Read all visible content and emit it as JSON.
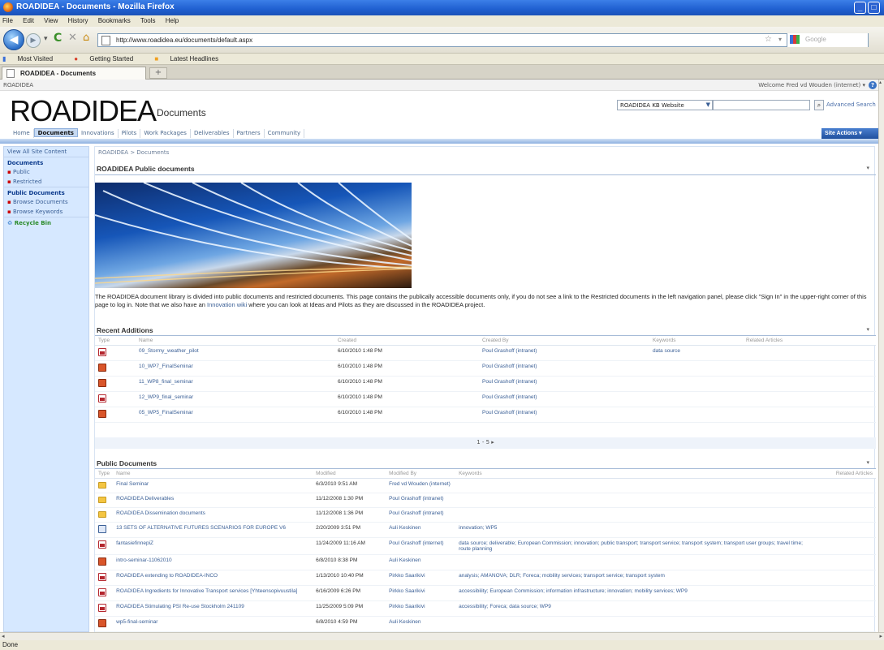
{
  "browser": {
    "window_title": "ROADIDEA - Documents - Mozilla Firefox",
    "menu": [
      "File",
      "Edit",
      "View",
      "History",
      "Bookmarks",
      "Tools",
      "Help"
    ],
    "url": "http://www.roadidea.eu/documents/default.aspx",
    "search_engine_placeholder": "Google",
    "bookmarks": [
      "Most Visited",
      "Getting Started",
      "Latest Headlines"
    ],
    "tab_title": "ROADIDEA - Documents",
    "new_tab_label": "+",
    "status": "Done"
  },
  "site": {
    "site_name": "ROADIDEA",
    "welcome": "Welcome Fred vd Wouden (internet) ▾",
    "logo_text": "ROADIDEA",
    "page_name": "Documents",
    "search_scope": "ROADIDEA KB Website",
    "advanced_search": "Advanced Search",
    "site_actions": "Site Actions ▾",
    "top_nav": [
      "Home",
      "Documents",
      "Innovations",
      "Pilots",
      "Work Packages",
      "Deliverables",
      "Partners",
      "Community"
    ],
    "top_nav_selected": "Documents"
  },
  "quick_launch": {
    "view_all": "View All Site Content",
    "documents_header": "Documents",
    "documents_items": [
      "Public",
      "Restricted"
    ],
    "public_documents_header": "Public Documents",
    "public_documents_items": [
      "Browse Documents",
      "Browse Keywords"
    ],
    "recycle_bin": "Recycle Bin"
  },
  "main": {
    "breadcrumb": "ROADIDEA > Documents",
    "public_docs_title": "ROADIDEA Public documents",
    "intro_part1": "The ROADIDEA document library is divided into public documents and restricted documents. This page contains the publically accessible documents only, if you do not see a link to the Restricted documents in the left navigation panel, please click \"Sign In\" in the upper-right corner of this page to log in. Note that we also have an ",
    "intro_link": "Innovation wiki",
    "intro_part2": " where you can look at Ideas and Pilots as they are discussed in the ROADIDEA project."
  },
  "recent_additions": {
    "title": "Recent Additions",
    "columns": [
      "Type",
      "Name",
      "Created",
      "Created By",
      "Keywords",
      "Related Articles"
    ],
    "rows": [
      {
        "type": "pdf",
        "name": "09_Stormy_weather_pilot",
        "created": "6/10/2010 1:48 PM",
        "created_by": "Poul Grashoff (intranet)",
        "keywords": "data source"
      },
      {
        "type": "ppt",
        "name": "10_WP7_FinalSeminar",
        "created": "6/10/2010 1:48 PM",
        "created_by": "Poul Grashoff (intranet)",
        "keywords": ""
      },
      {
        "type": "ppt",
        "name": "11_WP8_final_seminar",
        "created": "6/10/2010 1:48 PM",
        "created_by": "Poul Grashoff (intranet)",
        "keywords": ""
      },
      {
        "type": "pdf",
        "name": "12_WP9_final_seminar",
        "created": "6/10/2010 1:48 PM",
        "created_by": "Poul Grashoff (intranet)",
        "keywords": ""
      },
      {
        "type": "ppt",
        "name": "05_WP5_FinalSeminar",
        "created": "6/10/2010 1:48 PM",
        "created_by": "Poul Grashoff (intranet)",
        "keywords": ""
      }
    ],
    "pager": "1 - 5 ▸"
  },
  "public_documents": {
    "title": "Public Documents",
    "columns": [
      "Type",
      "Name",
      "Modified",
      "Modified By",
      "Keywords",
      "Related Articles"
    ],
    "rows": [
      {
        "type": "folder",
        "name": "Final Seminar",
        "modified": "6/3/2010 9:51 AM",
        "modified_by": "Fred vd Wouden (internet)",
        "keywords": ""
      },
      {
        "type": "folder",
        "name": "ROADIDEA Deliverables",
        "modified": "11/12/2008 1:30 PM",
        "modified_by": "Poul Grashoff (intranet)",
        "keywords": ""
      },
      {
        "type": "folder",
        "name": "ROADIDEA Dissemination documents",
        "modified": "11/12/2008 1:36 PM",
        "modified_by": "Poul Grashoff (intranet)",
        "keywords": ""
      },
      {
        "type": "xls",
        "name": "13 SETS OF ALTERNATIVE FUTURES SCENARIOS FOR EUROPE V6",
        "modified": "2/20/2009 3:51 PM",
        "modified_by": "Auli Keskinen",
        "keywords": "innovation; WP5"
      },
      {
        "type": "pdf",
        "name": "fantasiefinnepiZ",
        "modified": "11/24/2009 11:16 AM",
        "modified_by": "Poul Grashoff (internet)",
        "keywords": "data source; deliverable; European Commission; innovation; public transport; transport service; transport system; transport user groups; travel time; route planning"
      },
      {
        "type": "ppt",
        "name": "intro-seminar-11062010",
        "modified": "6/8/2010 8:38 PM",
        "modified_by": "Auli Keskinen",
        "keywords": ""
      },
      {
        "type": "pdf",
        "name": "ROADIDEA extending to ROADIDEA-INCO",
        "modified": "1/13/2010 10:40 PM",
        "modified_by": "Pirkko Saarikivi",
        "keywords": "analysis; AMANOVA; DLR; Foreca; mobility services; transport service; transport system"
      },
      {
        "type": "pdf",
        "name": "ROADIDEA Ingredients for Innovative Transport services [Yhteensopivuustila]",
        "modified": "6/16/2009 6:26 PM",
        "modified_by": "Pirkko Saarikivi",
        "keywords": "accessibility; European Commission; information infrastructure; innovation; mobility services; WP9"
      },
      {
        "type": "pdf",
        "name": "ROADIDEA Stimulating PSI Re-use Stockholm 241109",
        "modified": "11/25/2009 5:09 PM",
        "modified_by": "Pirkko Saarikivi",
        "keywords": "accessibility; Foreca; data source; WP9"
      },
      {
        "type": "ppt",
        "name": "wp5-final-seminar",
        "modified": "6/8/2010 4:59 PM",
        "modified_by": "Auli Keskinen",
        "keywords": ""
      }
    ]
  }
}
